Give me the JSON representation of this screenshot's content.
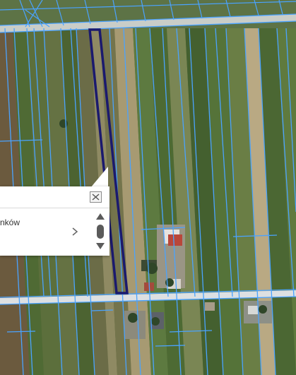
{
  "popup": {
    "row_label": "nków",
    "close_icon": "close-icon",
    "chevron_icon": "chevron-right-icon",
    "scroll_up_icon": "triangle-up-icon",
    "scroll_down_icon": "triangle-down-icon"
  },
  "colors": {
    "parcel_lines": "#4aa3ff",
    "selected_parcel": "#1b1a6e",
    "road": "#d9dde0"
  }
}
